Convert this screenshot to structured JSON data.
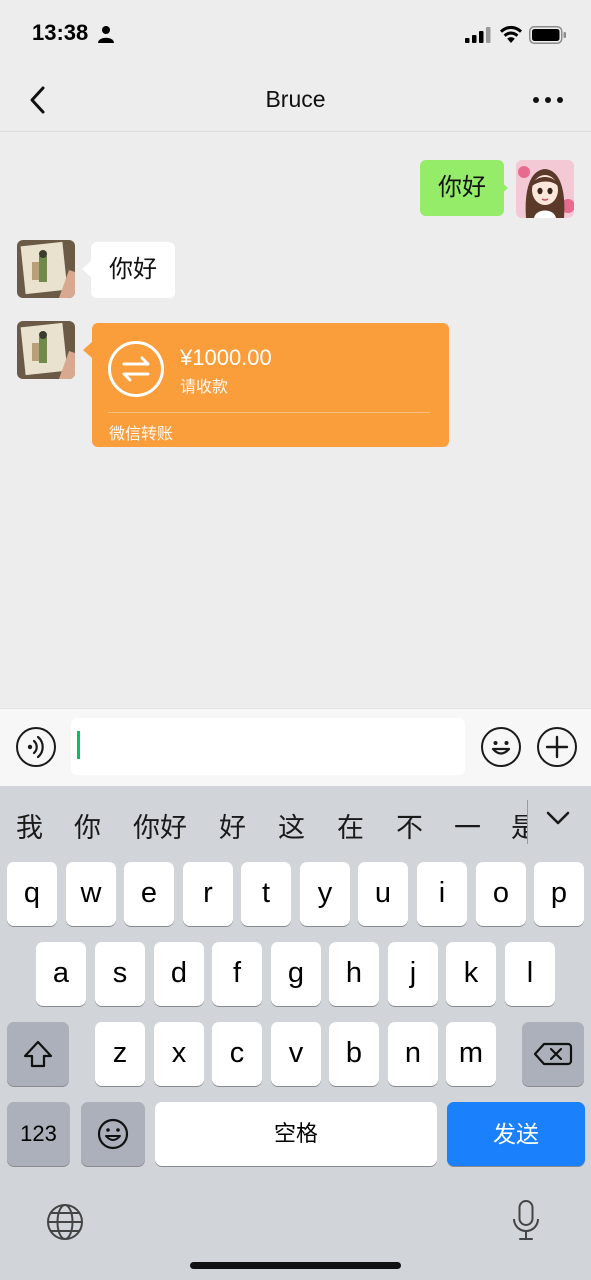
{
  "status_bar": {
    "time": "13:38"
  },
  "nav": {
    "title": "Bruce"
  },
  "messages": {
    "outgoing_text": "你好",
    "incoming_text": "你好",
    "transfer": {
      "amount": "¥1000.00",
      "note": "请收款",
      "footer": "微信转账"
    }
  },
  "input": {
    "value": ""
  },
  "keyboard": {
    "candidates": [
      "我",
      "你",
      "你好",
      "好",
      "这",
      "在",
      "不",
      "一",
      "是"
    ],
    "row1": [
      "q",
      "w",
      "e",
      "r",
      "t",
      "y",
      "u",
      "i",
      "o",
      "p"
    ],
    "row2": [
      "a",
      "s",
      "d",
      "f",
      "g",
      "h",
      "j",
      "k",
      "l"
    ],
    "row3": [
      "z",
      "x",
      "c",
      "v",
      "b",
      "n",
      "m"
    ],
    "num_label": "123",
    "space_label": "空格",
    "send_label": "发送"
  },
  "colors": {
    "outgoing_bubble": "#95ec69",
    "transfer_card": "#fa9d3b",
    "send_key": "#1a80fb",
    "caret": "#07c160"
  },
  "icons": [
    "person-icon",
    "signal-icon",
    "wifi-icon",
    "battery-icon",
    "back-arrow-icon",
    "more-icon",
    "voice-icon",
    "emoji-icon",
    "plus-icon",
    "transfer-arrows-icon",
    "chevron-down-icon",
    "shift-icon",
    "backspace-icon",
    "globe-icon",
    "microphone-icon"
  ]
}
